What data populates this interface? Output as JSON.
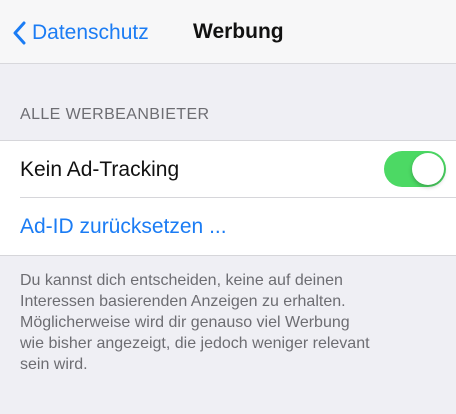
{
  "nav": {
    "back_label": "Datenschutz",
    "title": "Werbung"
  },
  "section": {
    "header": "ALLE WERBEANBIETER"
  },
  "rows": {
    "ad_tracking": {
      "label": "Kein Ad-Tracking",
      "toggle_on": true
    },
    "reset_id": {
      "label": "Ad-ID zurücksetzen ..."
    }
  },
  "footer": {
    "lines": [
      "Du kannst dich entscheiden, keine auf deinen",
      "Interessen basierenden Anzeigen zu erhalten.",
      "Möglicherweise wird dir genauso viel Werbung",
      "wie bisher angezeigt, die jedoch weniger relevant",
      "sein wird."
    ]
  },
  "colors": {
    "accent": "#1b7cf4",
    "toggle_on": "#4cd964",
    "background": "#efeff4"
  },
  "icons": {
    "back": "chevron-left-icon"
  }
}
